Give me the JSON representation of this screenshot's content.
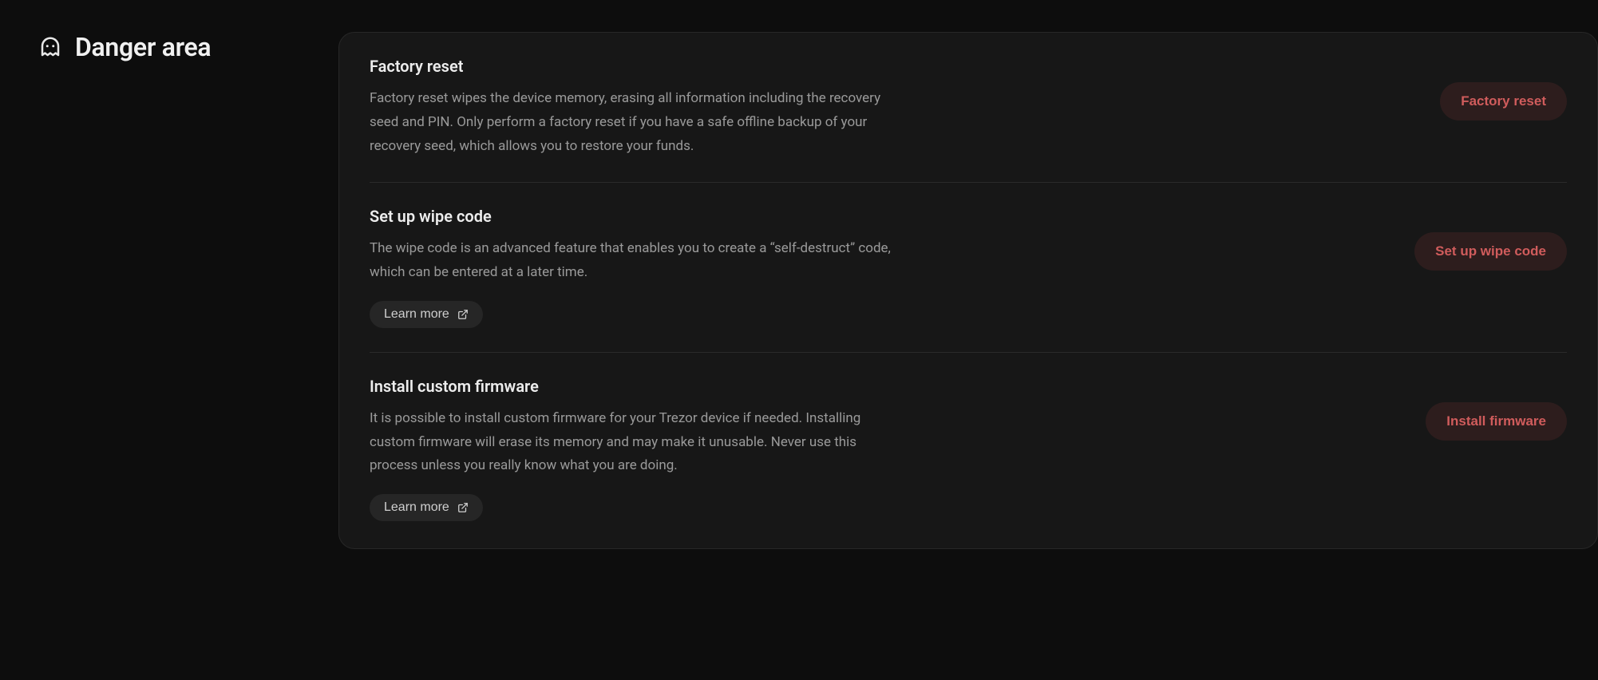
{
  "header": {
    "title": "Danger area"
  },
  "items": [
    {
      "title": "Factory reset",
      "description": "Factory reset wipes the device memory, erasing all information including the recovery seed and PIN. Only perform a factory reset if you have a safe offline backup of your recovery seed, which allows you to restore your funds.",
      "action_label": "Factory reset",
      "learn_more": null
    },
    {
      "title": "Set up wipe code",
      "description": "The wipe code is an advanced feature that enables you to create a “self-destruct” code, which can be entered at a later time.",
      "action_label": "Set up wipe code",
      "learn_more": "Learn more"
    },
    {
      "title": "Install custom firmware",
      "description": "It is possible to install custom firmware for your Trezor device if needed. Installing custom firmware will erase its memory and may make it unusable. Never use this process unless you really know what you are doing.",
      "action_label": "Install firmware",
      "learn_more": "Learn more"
    }
  ]
}
